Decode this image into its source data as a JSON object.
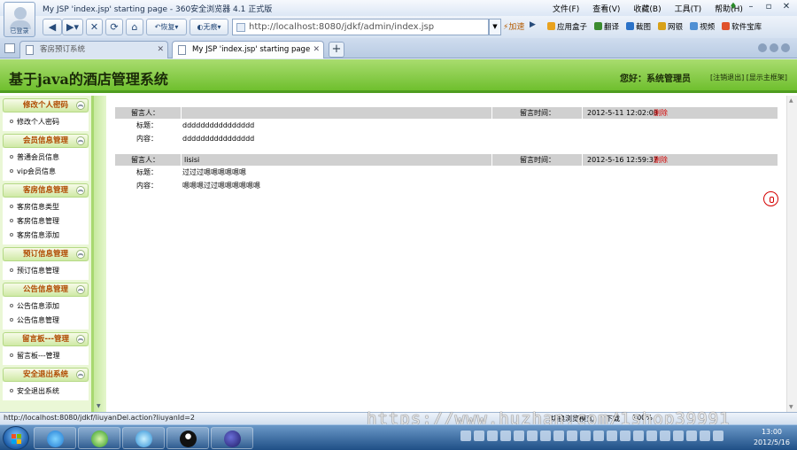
{
  "browser": {
    "window_title": "My JSP 'index.jsp' starting page - 360安全浏览器 4.1 正式版",
    "avatar_label": "已登录",
    "menu": [
      "文件(F)",
      "查看(V)",
      "收藏(B)",
      "工具(T)",
      "帮助(H)"
    ],
    "back_icon": "back-arrow-icon",
    "forward_icon": "forward-arrow-icon",
    "stop_label": "✕",
    "refresh_label": "⟳",
    "home_label": "⌂",
    "restore_label": "恢复",
    "incognito_label": "无痕",
    "address": "http://localhost:8080/jdkf/admin/index.jsp",
    "accelerate_label": "加速",
    "tools": [
      {
        "label": "应用盒子",
        "color": "#e9a21f"
      },
      {
        "label": "翻译",
        "color": "#3b8b2f"
      },
      {
        "label": "截图",
        "color": "#2b72c8"
      },
      {
        "label": "网银",
        "color": "#d8a118"
      },
      {
        "label": "视频",
        "color": "#4f8fd4"
      },
      {
        "label": "软件宝库",
        "color": "#e0512b"
      }
    ],
    "tabs": [
      {
        "label": "客房预订系统",
        "active": false
      },
      {
        "label": "My JSP 'index.jsp' starting page",
        "active": true
      }
    ],
    "new_tab_label": "+"
  },
  "page": {
    "system_title": "基于java的酒店管理系统",
    "welcome": "您好：系统管理员",
    "links": "[注销退出] [显示主框架]"
  },
  "sidebar": {
    "sections": [
      {
        "title": "修改个人密码",
        "items": [
          "修改个人密码"
        ]
      },
      {
        "title": "会员信息管理",
        "items": [
          "普通会员信息",
          "vip会员信息"
        ]
      },
      {
        "title": "客房信息管理",
        "items": [
          "客房信息类型",
          "客房信息管理",
          "客房信息添加"
        ]
      },
      {
        "title": "预订信息管理",
        "items": [
          "预订信息管理"
        ]
      },
      {
        "title": "公告信息管理",
        "items": [
          "公告信息添加",
          "公告信息管理"
        ]
      },
      {
        "title": "留言板---管理",
        "items": [
          "留言板---管理"
        ]
      },
      {
        "title": "安全退出系统",
        "items": [
          "安全退出系统"
        ]
      }
    ]
  },
  "messages": {
    "author_label": "留言人：",
    "time_label": "留言时间：",
    "title_label": "标题：",
    "content_label": "内容：",
    "entries": [
      {
        "author": "",
        "time": "2012-5-11 12:02:08",
        "action": "删除",
        "title": "dddddddddddddddd",
        "content": "dddddddddddddddd"
      },
      {
        "author": "lisisi",
        "time": "2012-5-16 12:59:37",
        "action": "删除",
        "title": "过过过嗯嗯嗯嗯嗯嗯",
        "content": "嗯嗯嗯过过嗯嗯嗯嗯嗯嗯"
      }
    ]
  },
  "status": {
    "url": "http://localhost:8080/jdkf/liuyanDel.action?liuyanId=2",
    "mode": "切换浏览模式",
    "download": "下载",
    "zoom": "100%"
  },
  "watermark": "https://www.huzhan.com/1shop39991",
  "taskbar": {
    "apps": [
      {
        "icon": "ie-icon",
        "color": "#2f8ee0"
      },
      {
        "icon": "360-browser-icon",
        "color": "#39a52f"
      },
      {
        "icon": "360-safe-icon",
        "color": "#3f9be0"
      },
      {
        "icon": "qq-icon",
        "color": "#111111"
      },
      {
        "icon": "eclipse-icon",
        "color": "#2d2b7a"
      }
    ],
    "time": "13:00",
    "date": "2012/5/16"
  }
}
